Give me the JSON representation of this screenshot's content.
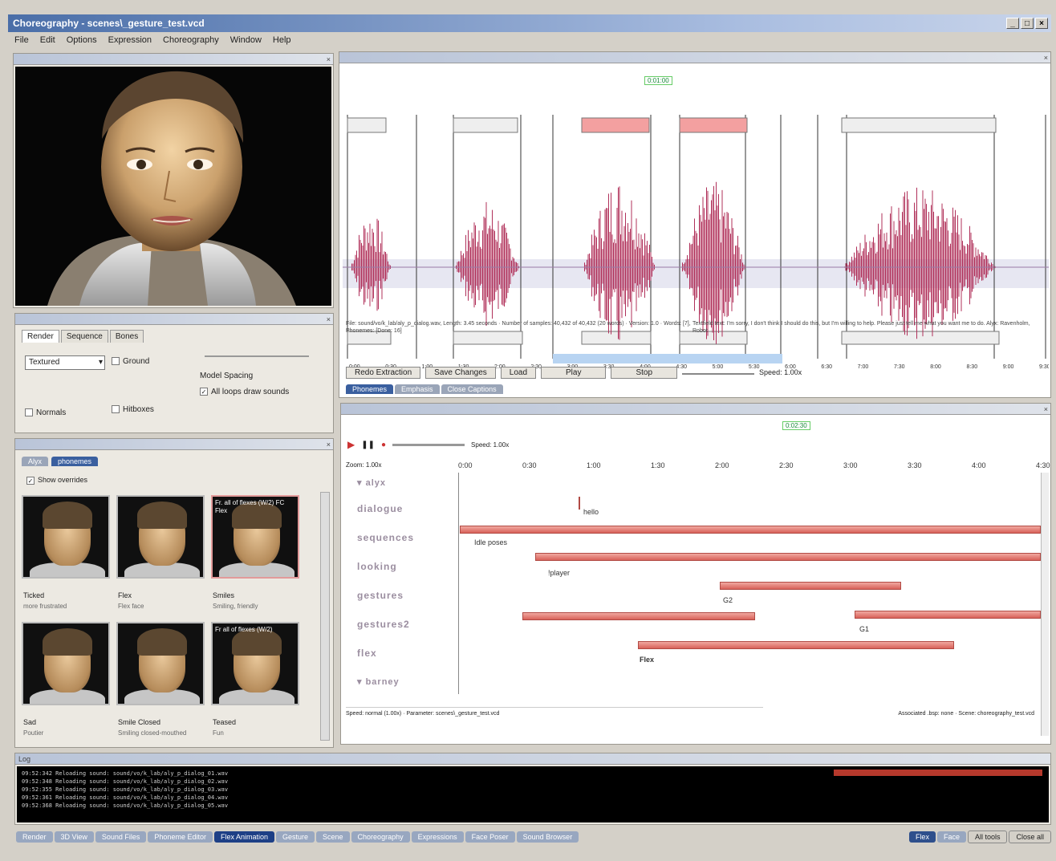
{
  "window": {
    "title": "Choreography - scenes\\_gesture_test.vcd"
  },
  "menu": [
    "File",
    "Edit",
    "Options",
    "Expression",
    "Choreography",
    "Window",
    "Help"
  ],
  "render_panel": {
    "tabs": [
      "Render",
      "Sequence",
      "Bones"
    ],
    "render_mode": "Textured",
    "ground_label": "Ground",
    "model_spacing_label": "Model Spacing",
    "normals_label": "Normals",
    "hitboxes_label": "Hitboxes",
    "all_loops_label": "All loops draw sounds"
  },
  "expressions_panel": {
    "tabs": [
      "Alyx",
      "phonemes"
    ],
    "show_checkbox_label": "Show overrides",
    "thumbs": [
      {
        "name": "Ticked",
        "sub": "more frustrated"
      },
      {
        "name": "Flex",
        "sub": "Flex face"
      },
      {
        "name": "Smiles",
        "sub": "Smiling, friendly",
        "overlay": "Fr. all of flexes (W/2) FC Flex"
      },
      {
        "name": "Sad",
        "sub": "Poutier"
      },
      {
        "name": "Smile Closed",
        "sub": "Smiling closed-mouthed"
      },
      {
        "name": "Teased",
        "sub": "Fun",
        "overlay": "Fr all of flexes (W/2)"
      }
    ]
  },
  "wave_panel": {
    "time_marker": "0:01:00",
    "ticks": [
      "0:00",
      "0:30",
      "1:00",
      "1:30",
      "2:00",
      "2:30",
      "3:00",
      "3:30",
      "4:00",
      "4:30",
      "5:00",
      "5:30",
      "6:00",
      "6:30",
      "7:00",
      "7:30",
      "8:00",
      "8:30",
      "9:00",
      "9:30"
    ],
    "info_left": "File: sound/vo/k_lab/aly_p_dialog.wav, Length: 3.45 seconds · Number of samples: 40,432 of 40,432 (20 words) · Version: 1.0 · Words: [7], Phonemes: [Done: 16]",
    "info_right": "Textfield text: I'm sorry, I don't think I should do this, but I'm willing to help. Please just tell me what you want me to do. Alyx: Ravenholm, Robot",
    "buttons": [
      "Redo Extraction",
      "Save Changes",
      "Load",
      "Play",
      "Stop"
    ],
    "speed": "Speed: 1.00x",
    "tabs": [
      "Phonemes",
      "Emphasis",
      "Close Captions"
    ]
  },
  "timeline": {
    "time_marker": "0:02:30",
    "speed": "Speed: 1.00x",
    "zoom": "Zoom: 1.00x",
    "ticks": [
      "0:00",
      "0:30",
      "1:00",
      "1:30",
      "2:00",
      "2:30",
      "3:00",
      "3:30",
      "4:00",
      "4:30"
    ],
    "actor_1": "alyx",
    "actor_2": "barney",
    "tracks": [
      "dialogue",
      "sequences",
      "looking",
      "gestures",
      "gestures2",
      "flex"
    ],
    "event_labels": {
      "dialogue": "hello",
      "sequences": "Idle poses",
      "looking": "!player",
      "gestures": "G2",
      "gestures2": "G1",
      "flex": "Flex"
    },
    "footer_left": "Speed: normal (1.00x) · Parameter: scenes\\_gesture_test.vcd",
    "footer_right": "Associated .bsp: none · Scene: choreography_test.vcd"
  },
  "log": {
    "title": "Log",
    "lines": [
      "09:52:342  Reloading sound: sound/vo/k_lab/aly_p_dialog_01.wav",
      "09:52:348  Reloading sound: sound/vo/k_lab/aly_p_dialog_02.wav",
      "09:52:355  Reloading sound: sound/vo/k_lab/aly_p_dialog_03.wav",
      "09:52:361  Reloading sound: sound/vo/k_lab/aly_p_dialog_04.wav",
      "09:52:368  Reloading sound: sound/vo/k_lab/aly_p_dialog_05.wav"
    ]
  },
  "taskbar": {
    "tabs": [
      "Render",
      "3D View",
      "Sound Files",
      "Phoneme Editor",
      "Flex Animation",
      "Gesture",
      "Scene",
      "Choreography",
      "Expressions",
      "Face Poser",
      "Sound Browser"
    ],
    "right_tabs": [
      "Flex",
      "Face",
      "All tools",
      "Close all"
    ]
  },
  "colors": {
    "accent": "#1d3f86",
    "event_bar": "#d8625a",
    "waveform": "#b0305a"
  }
}
